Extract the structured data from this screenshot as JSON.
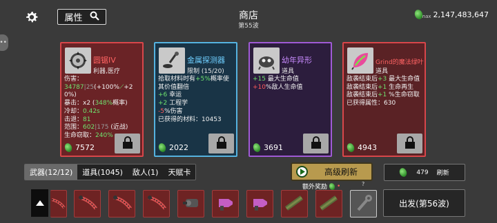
{
  "header": {
    "attr_label": "属性",
    "shop_title": "商店",
    "wave": "第55波",
    "materials": "2,147,483,647",
    "materials_max": "max"
  },
  "side_tab": "•••",
  "cards": [
    {
      "name": "圆锯IV",
      "sub": "利器,医疗",
      "lines": [
        [
          "伤害：",
          "34787",
          "25",
          "(+100%",
          "+2",
          "0%)"
        ],
        [
          "暴击：x2 (",
          "348%",
          "概率)"
        ],
        [
          "冷却：",
          "0.42s"
        ],
        [
          "击退：",
          "81"
        ],
        [
          "范围：",
          "602",
          "175",
          "(近战)"
        ],
        [
          "生命窃取：",
          "240%"
        ]
      ],
      "price": "7572",
      "border": "#d9464a",
      "bg": "#6a2326",
      "name_color": "#ff6363"
    },
    {
      "name": "金属探测器",
      "sub": "限制 (15/20)",
      "lines": [
        [
          "拾取材料时有",
          "+5%",
          "概率使其价值翻倍"
        ],
        [
          "+6",
          "幸运"
        ],
        [
          "+2",
          "工程学"
        ],
        [
          "-5",
          "%伤害"
        ],
        [
          "已获得的材料：",
          "10453"
        ]
      ],
      "price": "2022",
      "border": "#55b3e0",
      "bg": "#193446",
      "name_color": "#6fcfff"
    },
    {
      "name": "幼年异形",
      "sub": "道具",
      "lines": [
        [
          "+15",
          "最大生命值"
        ],
        [
          "+10",
          "%敌人生命值"
        ]
      ],
      "price": "3691",
      "border": "#a05ad6",
      "bg": "#2c1d3d",
      "name_color": "#c98bff"
    },
    {
      "name": "Grind的魔法绿叶",
      "sub": "道具",
      "lines": [
        [
          "敌袭结束后",
          "+3",
          "最大生命值"
        ],
        [
          "敌袭结束后",
          "+1",
          "生命再生"
        ],
        [
          "敌袭结束后",
          "+1",
          "%生命窃取"
        ],
        [
          "已获得属性：",
          "630"
        ]
      ],
      "price": "4943",
      "border": "#d9464a",
      "bg": "#5a2225",
      "name_color": "#ff6363"
    }
  ],
  "tabs": [
    "武器(12/12)",
    "道具(1045)",
    "敌人(1)",
    "天赋卡"
  ],
  "reroll_big": "高级刷新",
  "extra_reward": "额外奖励",
  "reroll_small_cost": "479",
  "reroll_small_label": "刷新",
  "question": "?",
  "depart": "出发(第56波)",
  "inventory": [
    "weapon-slot",
    "weapon-slot",
    "weapon-slot",
    "weapon-slot",
    "weapon-slot",
    "weapon-slot",
    "weapon-slot",
    "weapon-slot",
    "weapon-slot",
    "weapon-slot"
  ]
}
